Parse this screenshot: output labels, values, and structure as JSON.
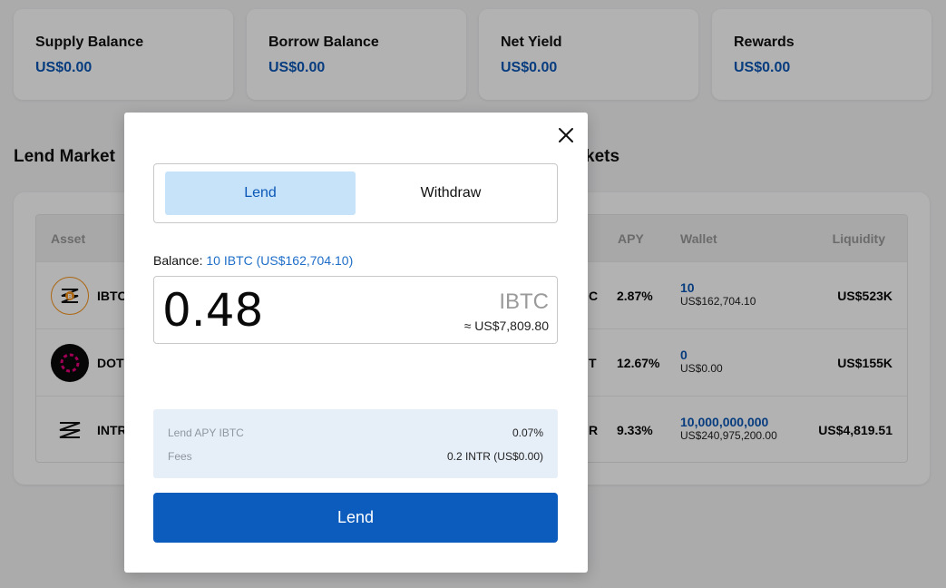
{
  "stats": [
    {
      "label": "Supply Balance",
      "value": "US$0.00"
    },
    {
      "label": "Borrow Balance",
      "value": "US$0.00"
    },
    {
      "label": "Net Yield",
      "value": "US$0.00"
    },
    {
      "label": "Rewards",
      "value": "US$0.00"
    }
  ],
  "lend_markets": {
    "title": "Lend Market",
    "header": {
      "asset": "Asset"
    },
    "rows": [
      {
        "asset": "IBTC",
        "icon": "ibtc-icon"
      },
      {
        "asset": "DOT",
        "icon": "dot-icon"
      },
      {
        "asset": "INTR",
        "icon": "intr-icon"
      }
    ]
  },
  "borrow_markets": {
    "title": "kets",
    "header": {
      "apy": "APY",
      "wallet": "Wallet",
      "liquidity": "Liquidity"
    },
    "rows": [
      {
        "asset_tail": "C",
        "apy": "2.87%",
        "wallet_amount": "10",
        "wallet_usd": "US$162,704.10",
        "liquidity": "US$523K"
      },
      {
        "asset_tail": "T",
        "apy": "12.67%",
        "wallet_amount": "0",
        "wallet_usd": "US$0.00",
        "liquidity": "US$155K"
      },
      {
        "asset_tail": "R",
        "apy": "9.33%",
        "wallet_amount": "10,000,000,000",
        "wallet_usd": "US$240,975,200.00",
        "liquidity": "US$4,819.51"
      }
    ]
  },
  "modal": {
    "close_icon": "close-icon",
    "tabs": [
      {
        "label": "Lend",
        "active": true
      },
      {
        "label": "Withdraw",
        "active": false
      }
    ],
    "balance_label": "Balance:",
    "balance_value": "10 IBTC (US$162,704.10)",
    "amount": "0.48",
    "ticker": "IBTC",
    "amount_usd": "≈ US$7,809.80",
    "info": [
      {
        "label": "Lend APY IBTC",
        "value": "0.07%"
      },
      {
        "label": "Fees",
        "value": "0.2 INTR (US$0.00)"
      }
    ],
    "submit_label": "Lend"
  },
  "colors": {
    "accent": "#0b5cbd",
    "link": "#0b57b7",
    "tab_active_bg": "#c6e3f9",
    "info_bg": "#e6eef8",
    "dot_brand": "#e6007a"
  }
}
